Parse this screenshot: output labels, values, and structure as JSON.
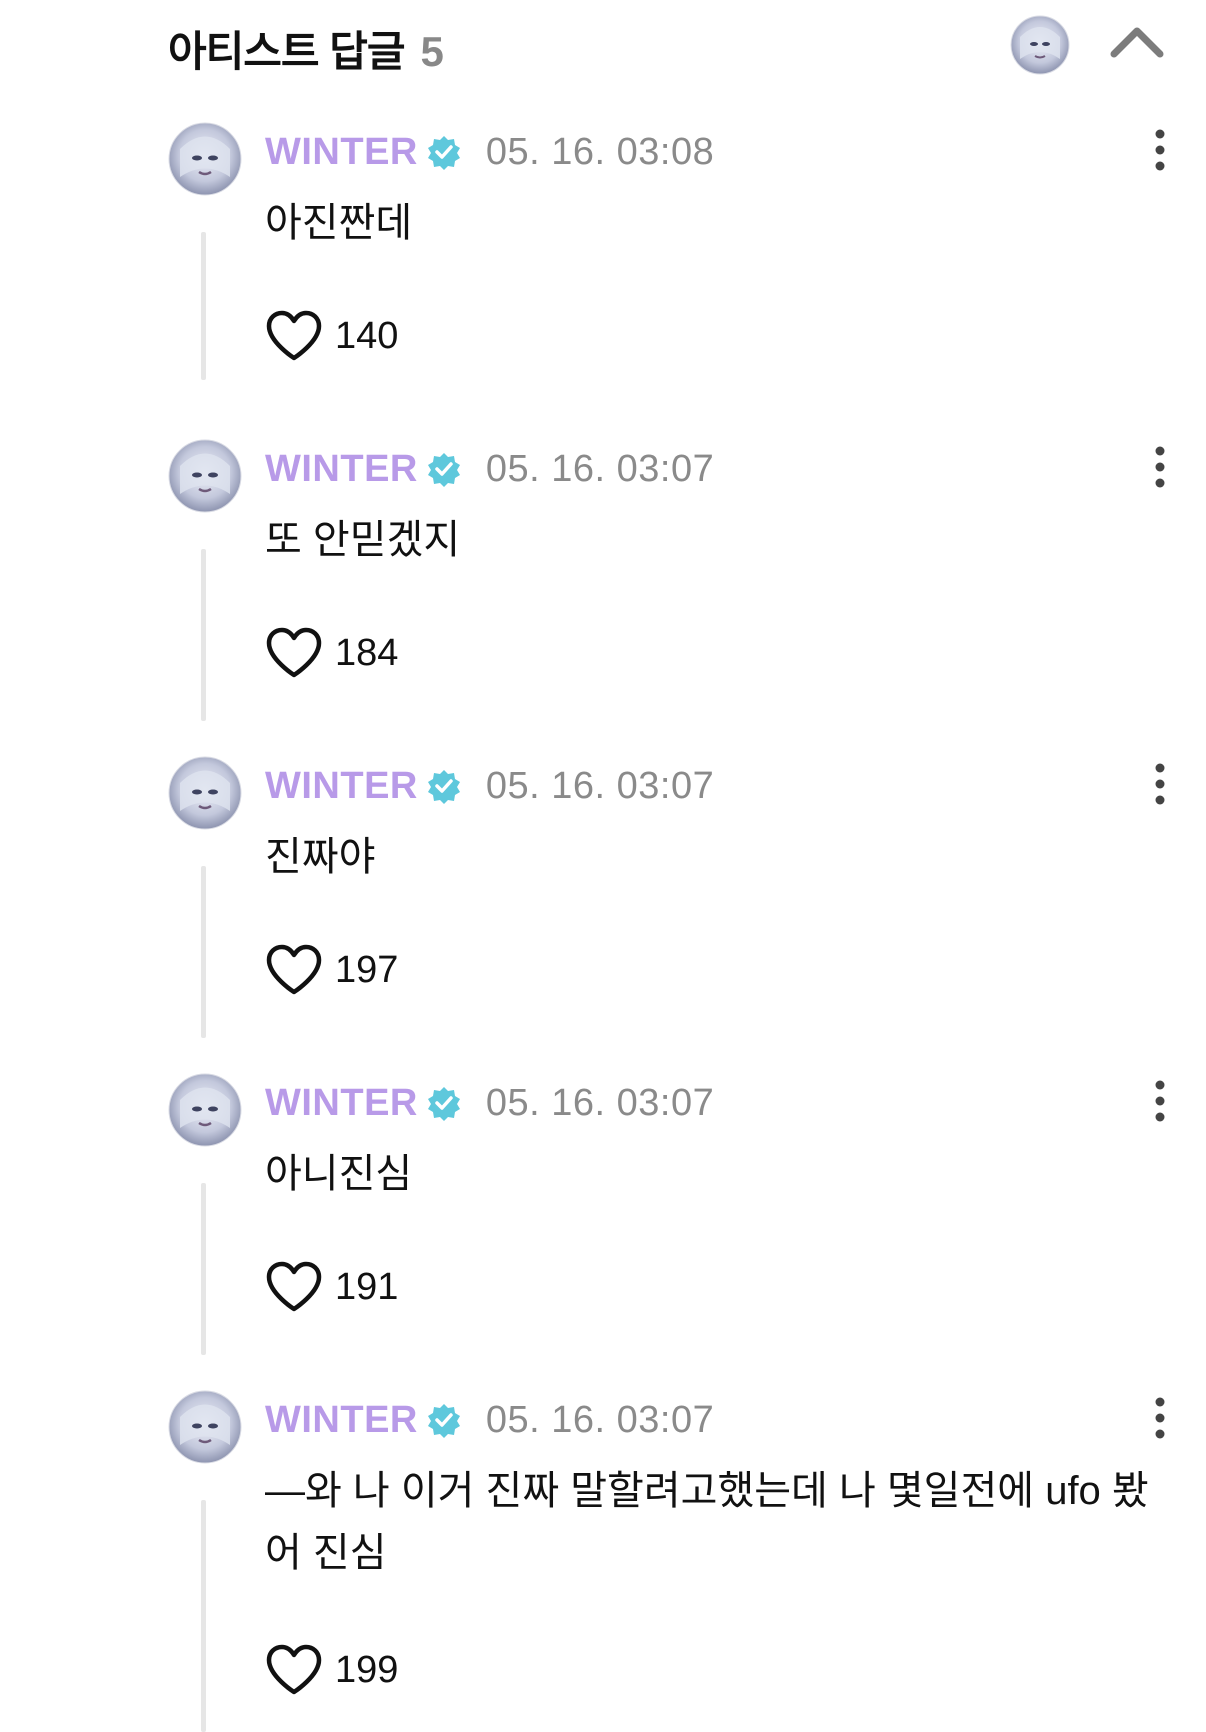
{
  "header": {
    "title": "아티스트 답글",
    "count": "5"
  },
  "comments": [
    {
      "author": "WINTER",
      "timestamp": "05. 16. 03:08",
      "text": "아진짠데",
      "likes": "140"
    },
    {
      "author": "WINTER",
      "timestamp": "05. 16. 03:07",
      "text": "또 안믿겠지",
      "likes": "184"
    },
    {
      "author": "WINTER",
      "timestamp": "05. 16. 03:07",
      "text": "진짜야",
      "likes": "197"
    },
    {
      "author": "WINTER",
      "timestamp": "05. 16. 03:07",
      "text": "아니진심",
      "likes": "191"
    },
    {
      "author": "WINTER",
      "timestamp": "05. 16. 03:07",
      "text": "—와 나 이거 진짜 말할려고했는데 나 몇일전에 ufo 봤어 진심",
      "likes": "199"
    }
  ],
  "colors": {
    "author": "#b89ae8",
    "verified_badge": "#5ec8dc",
    "timestamp": "#8a8a8a",
    "thread_line": "#e6e6e6"
  },
  "icons": {
    "verified": "verified-badge-icon",
    "like": "heart-outline-icon",
    "more": "more-vertical-icon",
    "collapse": "chevron-up-icon"
  }
}
